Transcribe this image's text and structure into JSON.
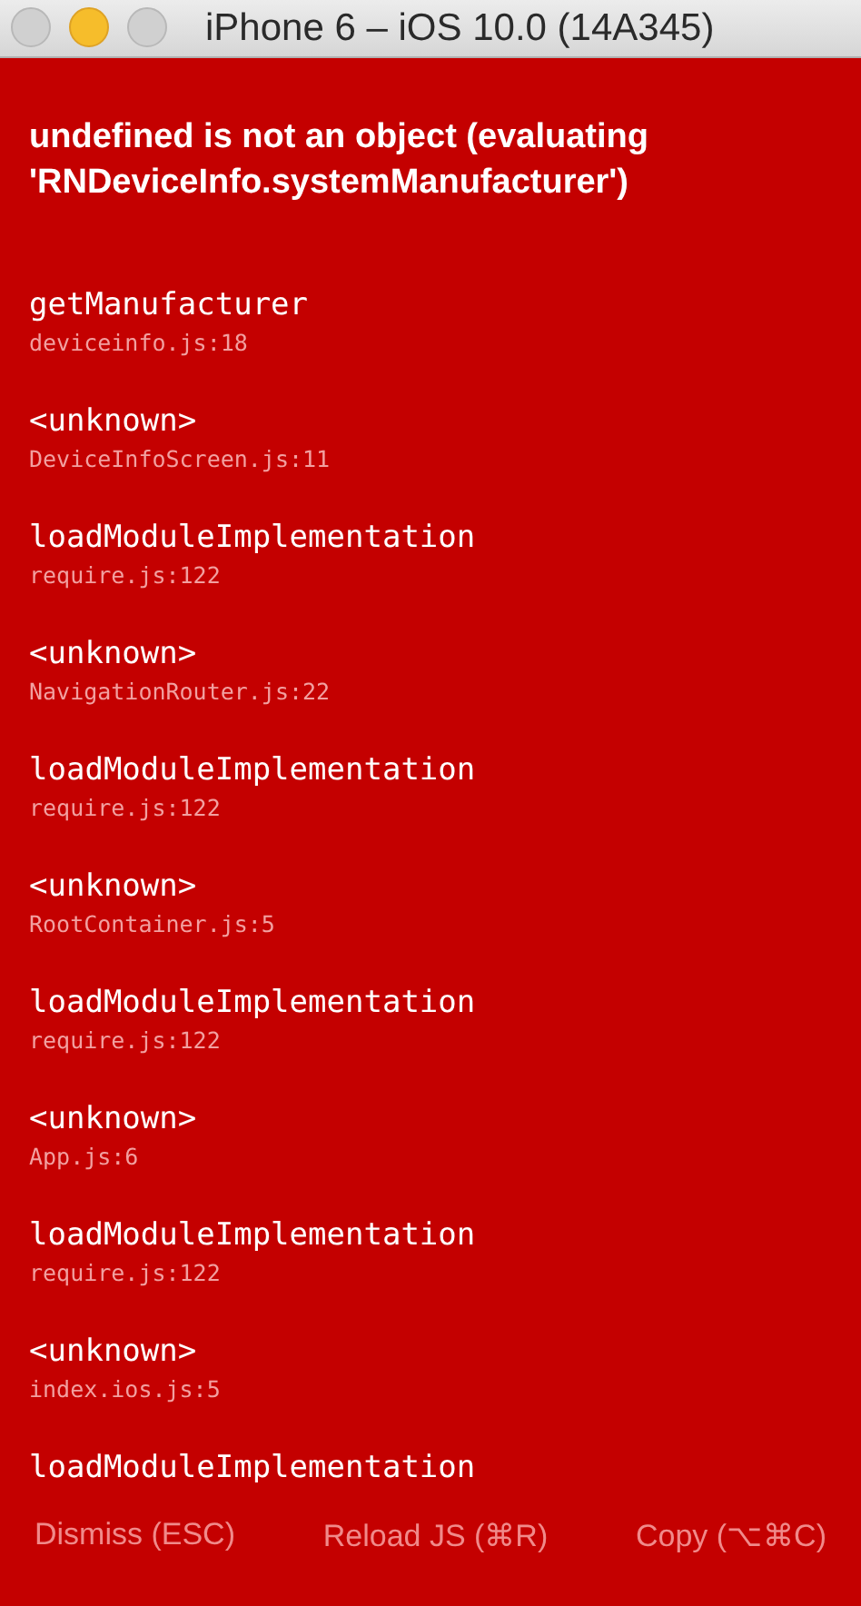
{
  "window": {
    "title": "iPhone 6 – iOS 10.0 (14A345)"
  },
  "error": {
    "message": "undefined is not an object (evaluating 'RNDeviceInfo.systemManufacturer')"
  },
  "stack": [
    {
      "method": "getManufacturer",
      "file": "deviceinfo.js:18"
    },
    {
      "method": "<unknown>",
      "file": "DeviceInfoScreen.js:11"
    },
    {
      "method": "loadModuleImplementation",
      "file": "require.js:122"
    },
    {
      "method": "<unknown>",
      "file": "NavigationRouter.js:22"
    },
    {
      "method": "loadModuleImplementation",
      "file": "require.js:122"
    },
    {
      "method": "<unknown>",
      "file": "RootContainer.js:5"
    },
    {
      "method": "loadModuleImplementation",
      "file": "require.js:122"
    },
    {
      "method": "<unknown>",
      "file": "App.js:6"
    },
    {
      "method": "loadModuleImplementation",
      "file": "require.js:122"
    },
    {
      "method": "<unknown>",
      "file": "index.ios.js:5"
    },
    {
      "method": "loadModuleImplementation"
    }
  ],
  "buttons": [
    "Dismiss (ESC)",
    "Reload JS (⌘R)",
    "Copy (⌥⌘C)"
  ]
}
